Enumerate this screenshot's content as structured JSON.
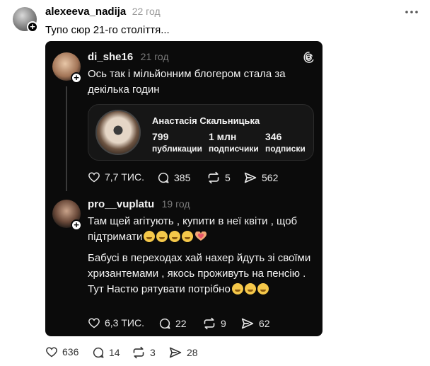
{
  "post": {
    "username": "alexeeva_nadija",
    "time": "22 год",
    "text": "Тупо сюр 21-го століття...",
    "more_icon": "more-dots-icon",
    "actions": {
      "likes": "636",
      "replies": "14",
      "reposts": "3",
      "shares": "28"
    }
  },
  "embed": {
    "logo_icon": "threads-logo-icon",
    "original": {
      "username": "di_she16",
      "time": "21 год",
      "text": "Ось так і мільйонним блогером стала за декілька годин",
      "profile": {
        "name": "Анастасія Скальницька",
        "stats": [
          {
            "value": "799",
            "label": "публикации"
          },
          {
            "value": "1 млн",
            "label": "подписчики"
          },
          {
            "value": "346",
            "label": "подписки"
          }
        ]
      },
      "actions": {
        "likes": "7,7 ТИС.",
        "replies": "385",
        "reposts": "5",
        "shares": "562"
      }
    },
    "reply": {
      "username": "pro__vuplatu",
      "time": "19 год",
      "para1": "Там щей агітують , купити в неї квіти , щоб підтримати",
      "para2": "Бабусі в переходах хай нахер йдуть зі своїми хризантемами , якось проживуть на пенсію . Тут Настю рятувати потрібно",
      "actions": {
        "likes": "6,3 ТИС.",
        "replies": "22",
        "reposts": "9",
        "shares": "62"
      }
    }
  },
  "colors": {
    "card_bg": "#0b0b0b",
    "profile_bg": "#161616",
    "muted": "#999999"
  }
}
